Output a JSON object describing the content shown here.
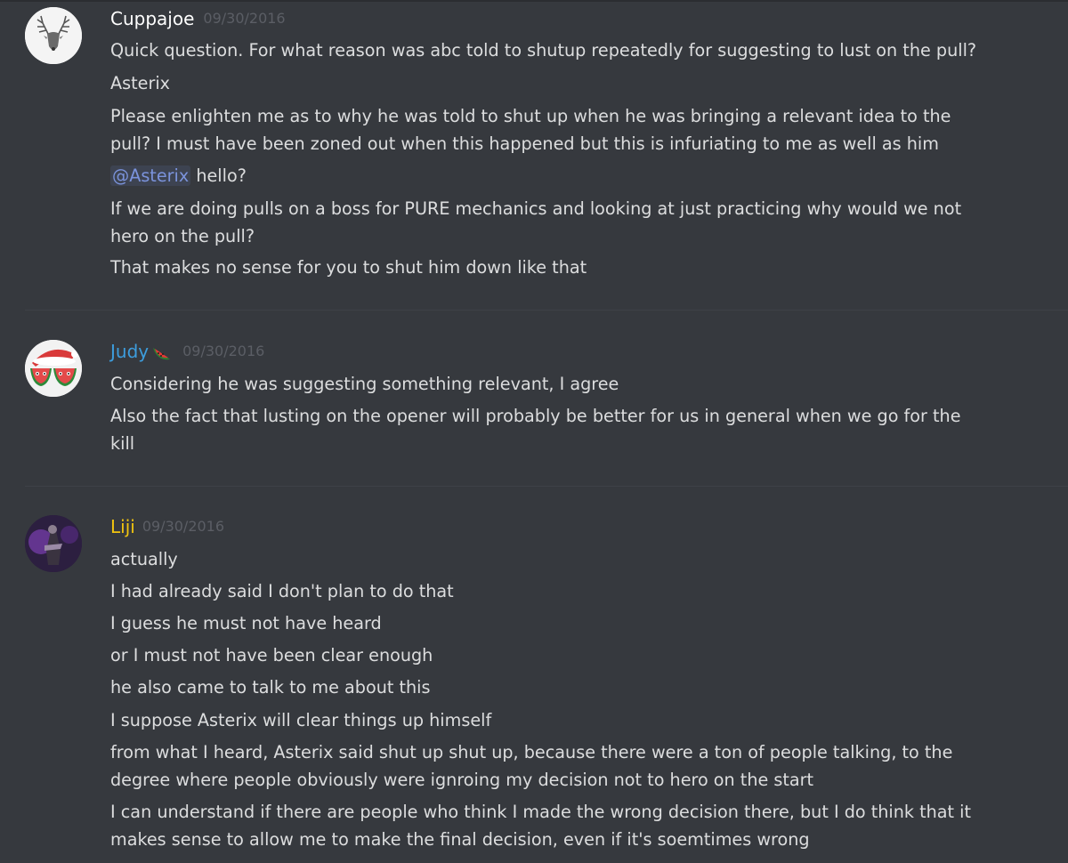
{
  "messages": [
    {
      "author": "Cuppajoe",
      "author_color": "#ffffff",
      "timestamp": "09/30/2016",
      "avatar_icon": "deer-avatar-icon",
      "lines": [
        "Quick question. For what reason was abc told to shutup repeatedly for suggesting to lust on the pull?",
        "Asterix",
        "Please enlighten me as to why he was told to shut up when he was bringing a relevant idea to the",
        "pull? I must have been zoned out when this happened but this is infuriating to me as well as him",
        "hello?",
        "If we are doing pulls on a boss for PURE mechanics and looking at just practicing why would we not",
        "hero on the pull?",
        "That makes no sense for you to shut him down like that"
      ],
      "mention": "@Asterix"
    },
    {
      "author": "Judy",
      "author_color": "#3d9ddd",
      "timestamp": "09/30/2016",
      "avatar_icon": "watermelon-santa-avatar-icon",
      "emoji_icon": "watermelon-icon",
      "lines": [
        "Considering he was suggesting something relevant, I agree",
        "Also the fact that lusting on the opener will probably be better for us in general when we go for the",
        "kill"
      ]
    },
    {
      "author": "Liji",
      "author_color": "#f1c40f",
      "timestamp": "09/30/2016",
      "avatar_icon": "character-avatar-icon",
      "lines": [
        "actually",
        "I had already said I don't plan to do that",
        "I guess he must not have heard",
        "or I must not have been clear enough",
        "he also came to talk to me about this",
        "I suppose Asterix will clear things up himself",
        "from what I heard, Asterix said shut up shut up, because there were a ton of people talking, to the",
        "degree where people obviously were ignroing my decision not to hero on the start",
        "I can understand if there are people who think I made the wrong decision there, but I do think that it",
        "makes sense to allow me to make the final decision, even if it's soemtimes wrong"
      ]
    }
  ]
}
